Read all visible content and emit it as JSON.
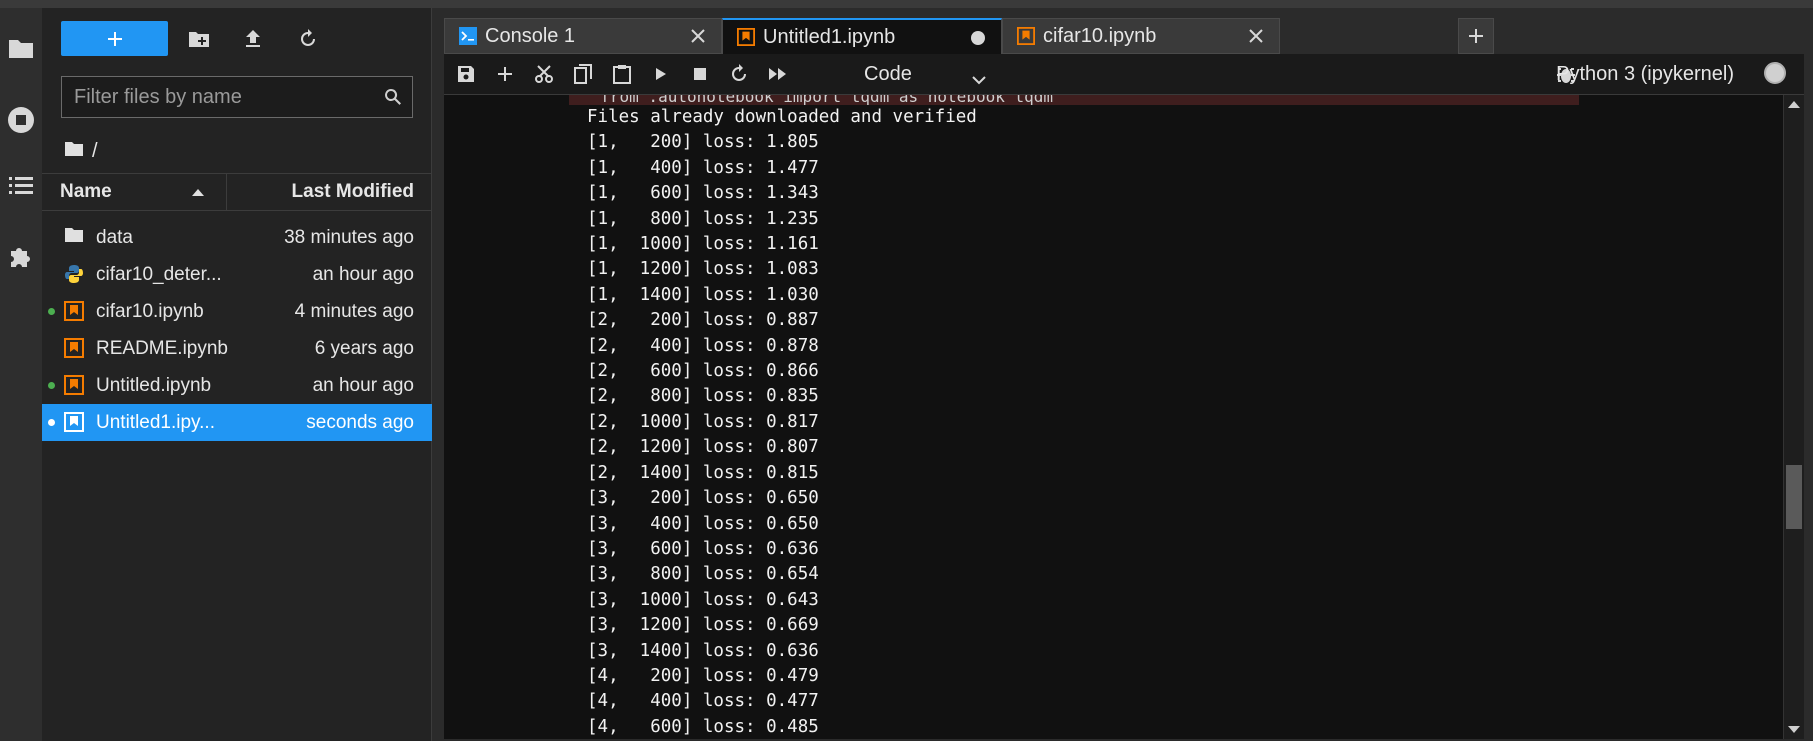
{
  "colors": {
    "accent": "#2196f3",
    "notebook_icon": "#f57c00",
    "modified_dot": "#4caf50",
    "python_blue": "#3776ab",
    "python_yellow": "#ffd43b"
  },
  "activity_bar": [
    {
      "name": "folder-icon"
    },
    {
      "name": "running-icon"
    },
    {
      "name": "toc-icon"
    },
    {
      "name": "extension-icon"
    }
  ],
  "file_browser": {
    "new_button_label": "+",
    "filter_placeholder": "Filter files by name",
    "breadcrumb": "/",
    "columns": {
      "name": "Name",
      "modified": "Last Modified"
    },
    "files": [
      {
        "name": "data",
        "modified": "38 minutes ago",
        "icon": "folder-icon",
        "running": false,
        "selected": false
      },
      {
        "name": "cifar10_deter...",
        "modified": "an hour ago",
        "icon": "python-icon",
        "running": false,
        "selected": false
      },
      {
        "name": "cifar10.ipynb",
        "modified": "4 minutes ago",
        "icon": "notebook-icon",
        "running": true,
        "selected": false
      },
      {
        "name": "README.ipynb",
        "modified": "6 years ago",
        "icon": "notebook-icon",
        "running": false,
        "selected": false
      },
      {
        "name": "Untitled.ipynb",
        "modified": "an hour ago",
        "icon": "notebook-icon",
        "running": true,
        "selected": false
      },
      {
        "name": "Untitled1.ipy...",
        "modified": "seconds ago",
        "icon": "notebook-icon",
        "running": true,
        "selected": true
      }
    ]
  },
  "tabs": [
    {
      "label": "Console 1",
      "icon": "console-icon",
      "active": false,
      "dirty": false
    },
    {
      "label": "Untitled1.ipynb",
      "icon": "notebook-icon",
      "active": true,
      "dirty": true
    },
    {
      "label": "cifar10.ipynb",
      "icon": "notebook-icon",
      "active": false,
      "dirty": false
    }
  ],
  "toolbar": {
    "cell_type": "Code",
    "kernel_name": "Python 3 (ipykernel)"
  },
  "notebook": {
    "previous_line": "  from .autonotebook import tqdm as notebook_tqdm",
    "output_lines": [
      "Files already downloaded and verified",
      "[1,   200] loss: 1.805",
      "[1,   400] loss: 1.477",
      "[1,   600] loss: 1.343",
      "[1,   800] loss: 1.235",
      "[1,  1000] loss: 1.161",
      "[1,  1200] loss: 1.083",
      "[1,  1400] loss: 1.030",
      "[2,   200] loss: 0.887",
      "[2,   400] loss: 0.878",
      "[2,   600] loss: 0.866",
      "[2,   800] loss: 0.835",
      "[2,  1000] loss: 0.817",
      "[2,  1200] loss: 0.807",
      "[2,  1400] loss: 0.815",
      "[3,   200] loss: 0.650",
      "[3,   400] loss: 0.650",
      "[3,   600] loss: 0.636",
      "[3,   800] loss: 0.654",
      "[3,  1000] loss: 0.643",
      "[3,  1200] loss: 0.669",
      "[3,  1400] loss: 0.636",
      "[4,   200] loss: 0.479",
      "[4,   400] loss: 0.477",
      "[4,   600] loss: 0.485"
    ]
  }
}
